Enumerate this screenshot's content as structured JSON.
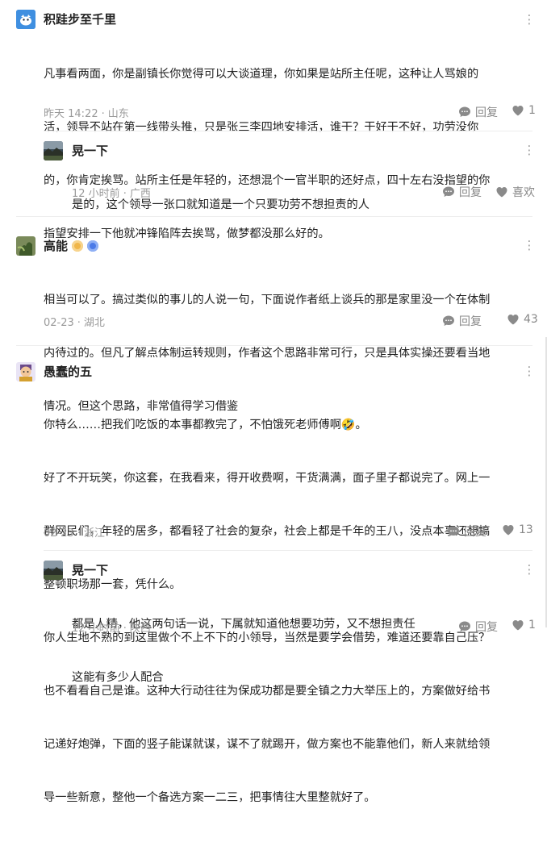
{
  "colors": {
    "text": "#222222",
    "meta": "#9a9a9a",
    "icon": "#8a8a8a"
  },
  "comments": [
    {
      "user": "积跬步至千里",
      "avatar": "bird-avatar",
      "lines": [
        "凡事看两面，你是副镇长你觉得可以大谈道理，你如果是站所主任呢，这种让人骂娘的",
        "活，领导不站在第一线带头推，只是张三李四地安排活，谁干？干好干不好，功劳没你",
        "的，你肯定挨骂。站所主任是年轻的，还想混个一官半职的还好点，四十左右没指望的你",
        "指望安排一下他就冲锋陷阵去挨骂，做梦都没那么好的。"
      ],
      "time": "昨天 14:22",
      "location": "山东",
      "reply_label": "回复",
      "like_label": "1",
      "replies": [
        {
          "user": "晃一下",
          "avatar": "landscape-avatar",
          "lines": [
            "是的，这个领导一张口就知道是一个只要功劳不想担责的人"
          ],
          "time": "12 小时前",
          "location": "广西",
          "reply_label": "回复",
          "like_label": "喜欢"
        }
      ]
    },
    {
      "user": "高能",
      "avatar": "plant-avatar",
      "lines": [
        "相当可以了。搞过类似的事儿的人说一句，下面说作者纸上谈兵的那是家里没一个在体制",
        "内待过的。但凡了解点体制运转规则，作者这个思路非常可行，只是具体实操还要看当地",
        "情况。但这个思路，非常值得学习借鉴"
      ],
      "time": "02-23",
      "location": "湖北",
      "reply_label": "回复",
      "like_label": "43",
      "replies": []
    },
    {
      "user": "愚蠢的五",
      "avatar": "cartoon-avatar",
      "lines": [
        "你特么……把我们吃饭的本事都教完了，不怕饿死老师傅啊🤣。",
        "好了不开玩笑，你这套，在我看来，得开收费啊，干货满满，面子里子都说完了。网上一",
        "群网民们，年轻的居多，都看轻了社会的复杂，社会上都是千年的王八，没点本事还想搞",
        "整顿职场那一套，凭什么。",
        "你人生地不熟的到这里做个不上不下的小领导，当然是要学会借势，难道还要靠自己压？",
        "也不看看自己是谁。这种大行动往往为保成功都是要全镇之力大举压上的，方案做好给书",
        "记递好炮弹，下面的竖子能谋就谋，谋不了就踢开，做方案也不能靠他们，新人来就给领",
        "导一些新意，整他一个备选方案一二三，把事情往大里整就好了。"
      ],
      "time": "02-23",
      "location": "浙江",
      "reply_label": "回复",
      "like_label": "13",
      "replies": [
        {
          "user": "晃一下",
          "avatar": "landscape-avatar",
          "lines": [
            "都是人精，他这两句话一说，下属就知道他想要功劳，又不想担责任",
            "这能有多少人配合"
          ],
          "time": "12 小时前",
          "location": "陕西",
          "reply_label": "回复",
          "like_label": "1"
        }
      ]
    }
  ]
}
